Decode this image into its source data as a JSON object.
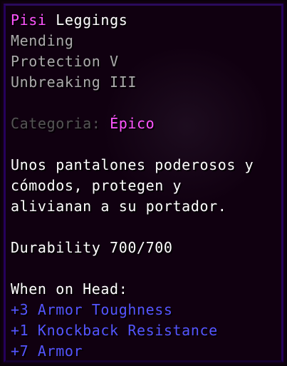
{
  "item": {
    "name_part1": "Pisi",
    "name_part2": " Leggings",
    "enchantments": [
      "Mending",
      "Protection V",
      "Unbreaking III"
    ],
    "category_label": "Categoria: ",
    "category_value": "Épico",
    "lore": [
      "Unos pantalones poderosos y",
      "cómodos, protegen y",
      "alivianan a su portador."
    ],
    "durability": "Durability 700/700",
    "slot_header": "When on Head:",
    "modifiers": [
      "+3 Armor Toughness",
      "+1 Knockback Resistance",
      "+7 Armor"
    ]
  },
  "colors": {
    "background": "#100010",
    "border": "#25015b",
    "name_highlight": "#ff55ff",
    "text": "#ffffff",
    "enchant": "#aaaaaa",
    "category_label": "#555555",
    "rarity": "#ff55ff",
    "modifier": "#5555ff"
  }
}
